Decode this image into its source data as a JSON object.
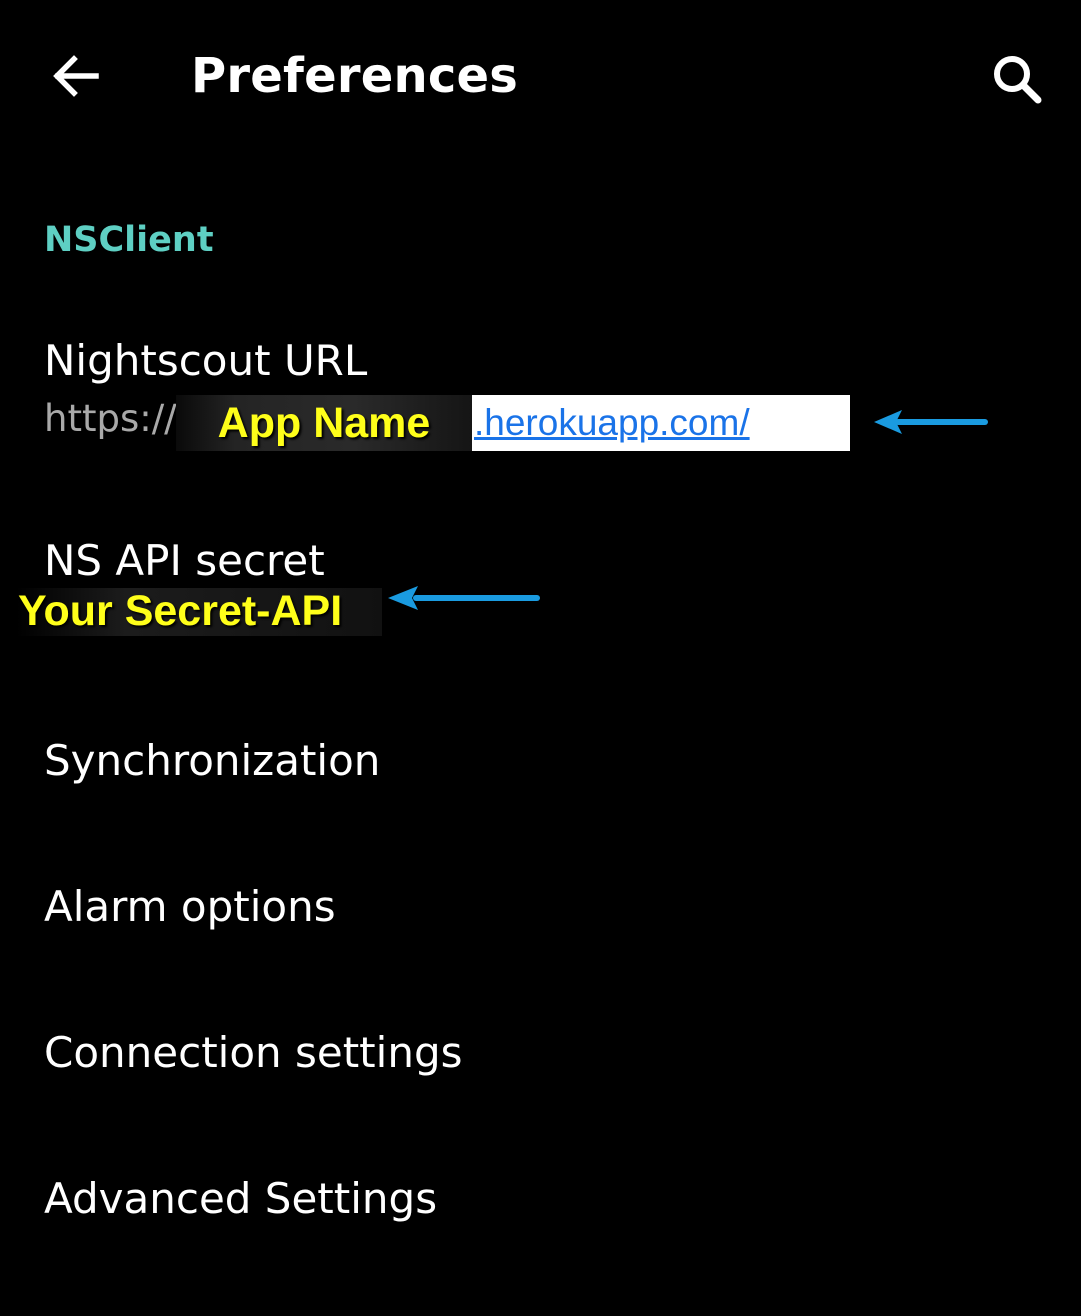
{
  "appbar": {
    "title": "Preferences",
    "back_icon": "arrow-left-icon",
    "search_icon": "search-icon"
  },
  "section": {
    "header": "NSClient",
    "color": "#5ecfc3"
  },
  "items": [
    {
      "title": "Nightscout URL",
      "summary_prefix": "https://",
      "summary_app_name": "App Name",
      "summary_suffix": ".herokuapp.com/"
    },
    {
      "title": "NS API secret",
      "summary": "Your Secret-API"
    },
    {
      "title": "Synchronization"
    },
    {
      "title": "Alarm options"
    },
    {
      "title": "Connection settings"
    },
    {
      "title": "Advanced Settings"
    }
  ],
  "annotations": {
    "arrow_color": "#1a9be0",
    "highlight_color": "#ffff1a",
    "link_color": "#1a73e8"
  }
}
